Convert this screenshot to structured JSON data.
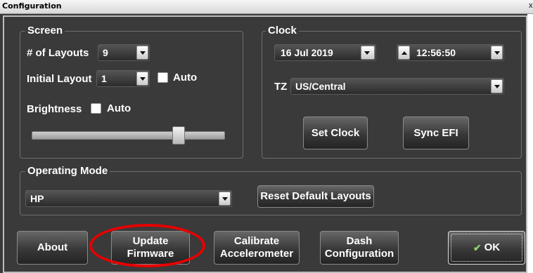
{
  "window": {
    "title": "Configuration",
    "close_glyph": "x"
  },
  "screen": {
    "legend": "Screen",
    "layouts_label": "# of Layouts",
    "layouts_value": "9",
    "initial_label": "Initial Layout",
    "initial_value": "1",
    "auto_label": "Auto",
    "auto_checked": false,
    "brightness_label": "Brightness",
    "brightness_auto_label": "Auto",
    "brightness_auto_checked": false,
    "brightness_level": 0.78
  },
  "clock": {
    "legend": "Clock",
    "date": "16 Jul 2019",
    "time": "12:56:50",
    "tz_label": "TZ",
    "tz_value": "US/Central",
    "set_clock": "Set Clock",
    "sync_efi": "Sync EFI"
  },
  "mode": {
    "legend": "Operating Mode",
    "value": "HP",
    "reset_layouts": "Reset Default Layouts"
  },
  "buttons": {
    "about": "About",
    "update_1": "Update",
    "update_2": "Firmware",
    "calibrate_1": "Calibrate",
    "calibrate_2": "Accelerometer",
    "dash_1": "Dash",
    "dash_2": "Configuration",
    "ok": "OK",
    "ok_icon": "check-icon"
  },
  "colors": {
    "background": "#3a3a3a",
    "annotation": "#e60000"
  }
}
